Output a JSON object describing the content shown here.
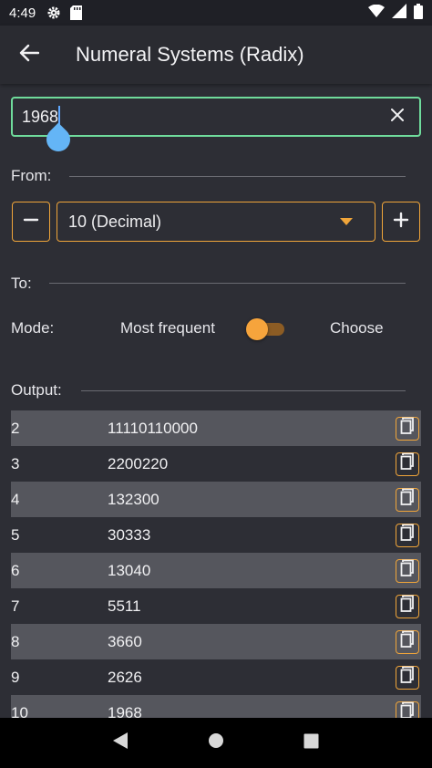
{
  "status_bar": {
    "time": "4:49",
    "icons": [
      "gear-icon",
      "sd-card-icon",
      "wifi-icon",
      "signal-icon",
      "battery-icon"
    ]
  },
  "app_bar": {
    "title": "Numeral Systems (Radix)"
  },
  "input": {
    "value": "1968"
  },
  "from": {
    "label": "From:",
    "minus_label": "−",
    "plus_label": "+",
    "selected": "10 (Decimal)"
  },
  "to": {
    "label": "To:"
  },
  "mode": {
    "label": "Mode:",
    "option_left": "Most frequent",
    "option_right": "Choose"
  },
  "output": {
    "label": "Output:",
    "rows": [
      {
        "base": "2",
        "value": "11110110000"
      },
      {
        "base": "3",
        "value": "2200220"
      },
      {
        "base": "4",
        "value": "132300"
      },
      {
        "base": "5",
        "value": "30333"
      },
      {
        "base": "6",
        "value": "13040"
      },
      {
        "base": "7",
        "value": "5511"
      },
      {
        "base": "8",
        "value": "3660"
      },
      {
        "base": "9",
        "value": "2626"
      },
      {
        "base": "10",
        "value": "1968"
      }
    ]
  },
  "colors": {
    "accent": "#f0a53a",
    "input_border": "#6fdc9c",
    "background": "#2d2e35",
    "row_shaded": "#55565d"
  }
}
